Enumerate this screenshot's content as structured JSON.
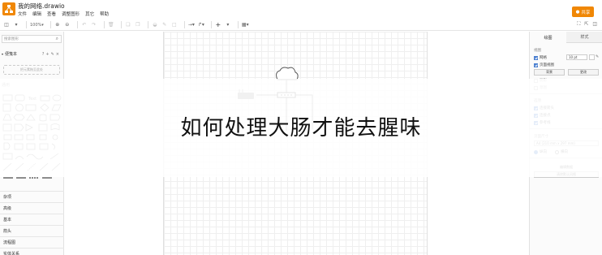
{
  "app": {
    "title": "我的网络.drawio",
    "menu": [
      "文件",
      "编辑",
      "查看",
      "调整图形",
      "其它",
      "帮助"
    ],
    "share_label": "共享",
    "brand_color": "#f08705"
  },
  "toolbar": {
    "zoom_label": "100%",
    "icons": [
      "format-panel-icon",
      "zoom-in-icon",
      "zoom-out-icon",
      "undo-icon",
      "redo-icon",
      "delete-icon",
      "fill-color-icon",
      "line-color-icon",
      "connection-icon",
      "waypoint-icon",
      "insert-icon",
      "table-icon",
      "fullscreen-icon"
    ]
  },
  "left_panel": {
    "search_placeholder": "搜索图形",
    "scratchpad_label": "便笺本",
    "scratchpad_drop": "把元素拖至此处",
    "general_label": "通用",
    "categories": [
      "杂项",
      "高级",
      "基本",
      "箭头",
      "流程图",
      "实体关系"
    ]
  },
  "right_panel": {
    "tabs": [
      "绘图",
      "样式"
    ],
    "grid_section": "视图",
    "grid_label": "网格",
    "grid_size": "10 pt",
    "page_view_label": "页面视图",
    "background_label": "背景",
    "change_label": "更改",
    "shadow_label": "阴影",
    "sketch_label": "草图",
    "options_section": "选项",
    "connection_arrows": "连接箭头",
    "connection_points": "连接点",
    "guides_label": "参考线",
    "paper_size_section": "页面尺寸",
    "paper_size_value": "A4 (210 mm x 297 mm)",
    "portrait_label": "纵向",
    "landscape_label": "横向",
    "edit_data": "编辑数据",
    "clear_default_style": "清除默认风格"
  },
  "banner": {
    "text": "如何处理大肠才能去腥味"
  }
}
